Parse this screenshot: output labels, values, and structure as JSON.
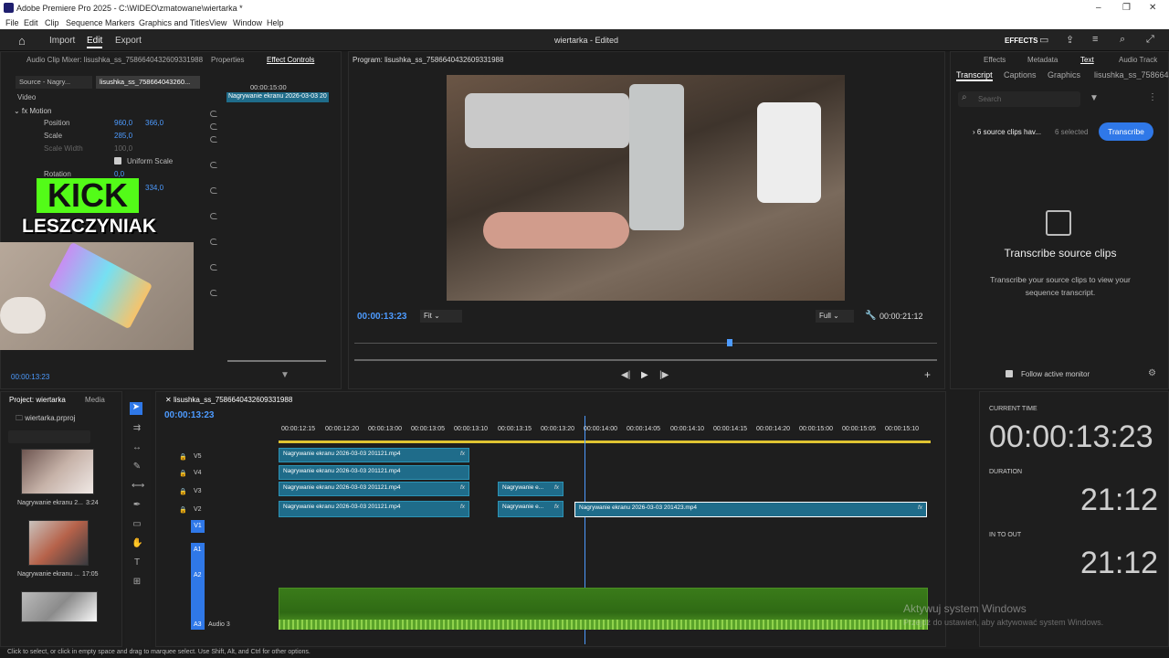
{
  "app": {
    "title": "Adobe Premiere Pro 2025 - C:\\WIDEO\\zmatowane\\wiertarka *"
  },
  "menu": [
    "File",
    "Edit",
    "Clip",
    "Sequence",
    "Markers",
    "Graphics and Titles",
    "View",
    "Window",
    "Help"
  ],
  "header": {
    "tabs": [
      "Import",
      "Edit",
      "Export"
    ],
    "active": "Edit",
    "doc_title": "wiertarka - Edited",
    "effects_label": "EFFECTS"
  },
  "effect_panel": {
    "tabs": [
      "Audio Clip Mixer: lisushka_ss_7586640432609331988",
      "Properties",
      "Effect Controls"
    ],
    "source_tab": "Source - Nagry...",
    "seq_tab": "lisushka_ss_758664043260...",
    "video_label": "Video",
    "motion_label": "Motion",
    "position_label": "Position",
    "position_x": "960,0",
    "position_y": "366,0",
    "scale_label": "Scale",
    "scale_value": "285,0",
    "scale_width_label": "Scale Width",
    "scale_width_value": "100,0",
    "uniform_scale_label": "Uniform Scale",
    "rotation_label": "Rotation",
    "rotation_value": "0,0",
    "anchor_value": "334,0",
    "clip_name": "Nagrywanie ekranu 2026-03-03 20",
    "timecode_top": "00:00:15:00",
    "bottom_time": "00:00:13:23"
  },
  "overlay": {
    "kick": "KICK",
    "name": "LESZCZYNIAK"
  },
  "program": {
    "title": "Program: lisushka_ss_7586640432609331988",
    "timecode": "00:00:13:23",
    "fit": "Fit",
    "quality": "Full",
    "duration": "00:00:21:12"
  },
  "right_panel": {
    "tabs": [
      "Effects",
      "Metadata",
      "Text",
      "Audio Track"
    ],
    "subtabs": [
      "Transcript",
      "Captions",
      "Graphics",
      "lisushka_ss_758664"
    ],
    "search_placeholder": "Search",
    "source_clips": "6 source clips hav...",
    "selected": "6 selected",
    "transcribe_btn": "Transcribe",
    "heading": "Transcribe source clips",
    "body": "Transcribe your source clips to view your sequence transcript.",
    "follow": "Follow active monitor"
  },
  "project": {
    "tabs": [
      "Project: wiertarka",
      "Media"
    ],
    "file": "wiertarka.prproj",
    "items": [
      {
        "name": "Nagrywanie ekranu 2...",
        "dur": "3:24"
      },
      {
        "name": "Nagrywanie ekranu ...",
        "dur": "17:05"
      }
    ]
  },
  "timeline": {
    "seq_name": "lisushka_ss_7586640432609331988",
    "timecode": "00:00:13:23",
    "ruler": [
      "00:00:12:15",
      "00:00:12:20",
      "00:00:13:00",
      "00:00:13:05",
      "00:00:13:10",
      "00:00:13:15",
      "00:00:13:20",
      "00:00:14:00",
      "00:00:14:05",
      "00:00:14:10",
      "00:00:14:15",
      "00:00:14:20",
      "00:00:15:00",
      "00:00:15:05",
      "00:00:15:10"
    ],
    "tracks_v": [
      "V5",
      "V4",
      "V3",
      "V2",
      "V1"
    ],
    "tracks_a": [
      "A1",
      "A2",
      "A3"
    ],
    "audio3": "Audio 3",
    "clip_long": "Nagrywanie ekranu 2026-03-03 201121.mp4",
    "clip_short": "Nagrywanie e...",
    "clip_sel": "Nagrywanie ekranu 2026-03-03 201423.mp4",
    "fx": "fx"
  },
  "time_panel": {
    "current_label": "CURRENT TIME",
    "current": "00:00:13:23",
    "duration_label": "DURATION",
    "duration": "21:12",
    "inout_label": "IN TO OUT",
    "inout": "21:12"
  },
  "watermark": {
    "line1": "Aktywuj system Windows",
    "line2": "Przejdź do ustawień, aby aktywować system Windows."
  },
  "status": "Click to select, or click in empty space and drag to marquee select. Use Shift, Alt, and Ctrl for other options."
}
